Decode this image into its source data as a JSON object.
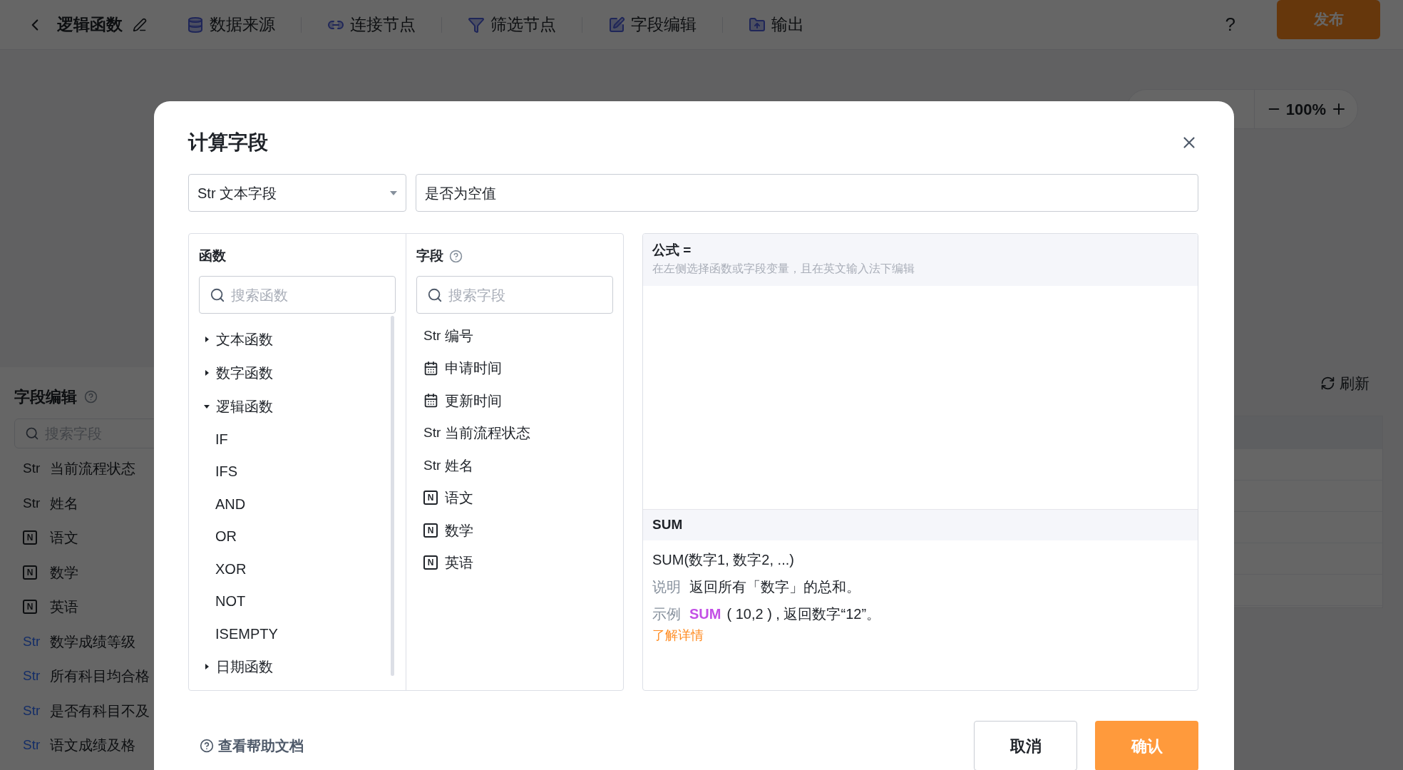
{
  "top_bar": {
    "title": "逻辑函数",
    "nav": [
      {
        "label": "数据来源"
      },
      {
        "label": "连接节点"
      },
      {
        "label": "筛选节点"
      },
      {
        "label": "字段编辑"
      },
      {
        "label": "输出"
      }
    ],
    "help": "?",
    "publish": "发布"
  },
  "zoom_control": {
    "value": "100%"
  },
  "field_panel": {
    "title": "字段编辑",
    "search_placeholder": "搜索字段",
    "items": [
      {
        "kind": "text",
        "tag": "Str",
        "name": "当前流程状态",
        "computed": false
      },
      {
        "kind": "text",
        "tag": "Str",
        "name": "姓名",
        "computed": false
      },
      {
        "kind": "number",
        "tag": "N",
        "name": "语文"
      },
      {
        "kind": "number",
        "tag": "N",
        "name": "数学"
      },
      {
        "kind": "number",
        "tag": "N",
        "name": "英语"
      },
      {
        "kind": "text",
        "tag": "Str",
        "name": "数学成绩等级",
        "computed": true
      },
      {
        "kind": "text",
        "tag": "Str",
        "name": "所有科目均合格",
        "computed": true
      },
      {
        "kind": "text",
        "tag": "Str",
        "name": "是否有科目不及",
        "computed": true
      },
      {
        "kind": "text",
        "tag": "Str",
        "name": "语文成绩及格",
        "computed": true
      }
    ]
  },
  "refresh": "刷新",
  "dialog": {
    "title": "计算字段",
    "type_select": {
      "tag": "Str",
      "value": "文本字段"
    },
    "name_field": {
      "value": "是否为空值"
    },
    "functions": {
      "title": "函数",
      "search_placeholder": "搜索函数",
      "groups": [
        {
          "label": "文本函数",
          "expanded": false
        },
        {
          "label": "数字函数",
          "expanded": false
        },
        {
          "label": "逻辑函数",
          "expanded": true,
          "children": [
            {
              "label": "IF"
            },
            {
              "label": "IFS"
            },
            {
              "label": "AND"
            },
            {
              "label": "OR"
            },
            {
              "label": "XOR"
            },
            {
              "label": "NOT"
            },
            {
              "label": "ISEMPTY"
            }
          ]
        },
        {
          "label": "日期函数",
          "expanded": false
        }
      ]
    },
    "fields": {
      "title": "字段",
      "search_placeholder": "搜索字段",
      "items": [
        {
          "kind": "text",
          "tag": "Str",
          "name": "编号"
        },
        {
          "kind": "date",
          "name": "申请时间"
        },
        {
          "kind": "date",
          "name": "更新时间"
        },
        {
          "kind": "text",
          "tag": "Str",
          "name": "当前流程状态"
        },
        {
          "kind": "text",
          "tag": "Str",
          "name": "姓名"
        },
        {
          "kind": "number",
          "tag": "N",
          "name": "语文"
        },
        {
          "kind": "number",
          "tag": "N",
          "name": "数学"
        },
        {
          "kind": "number",
          "tag": "N",
          "name": "英语"
        }
      ]
    },
    "formula": {
      "label": "公式 =",
      "hint": "在左侧选择函数或字段变量，且在英文输入法下编辑"
    },
    "function_help": {
      "name": "SUM",
      "signature": "SUM(数字1, 数字2, ...)",
      "description_label": "说明",
      "description": "返回所有「数字」的总和。",
      "example_label": "示例",
      "example_function": "SUM",
      "example_rest": "( 10,2 ) , 返回数字“12”。",
      "link": "了解详情"
    },
    "help_link": "查看帮助文档",
    "cancel": "取消",
    "confirm": "确认"
  }
}
